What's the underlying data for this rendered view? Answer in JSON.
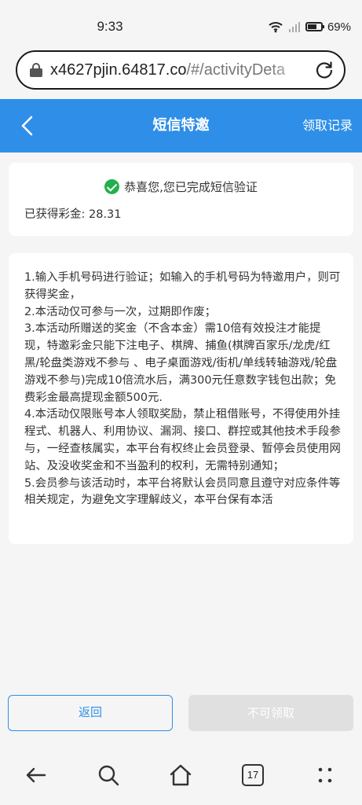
{
  "status_bar": {
    "time": "9:33",
    "battery_percent": "69%",
    "icons": [
      "wifi-icon",
      "signal-icon",
      "battery-icon"
    ]
  },
  "url_bar": {
    "host": "x4627pjin.64817.co",
    "path": "/#/activityDeta",
    "icons": [
      "lock-icon",
      "reload-icon"
    ]
  },
  "header": {
    "title": "短信特邀",
    "records_link": "领取记录",
    "background": "#2f8fe8"
  },
  "verification": {
    "message": "恭喜您,您已完成短信验证",
    "bonus_label": "已获得彩金: 28.31",
    "check_color": "#22b04a"
  },
  "rules": {
    "paragraphs": [
      "1.输入手机号码进行验证；如输入的手机号码为特邀用户，则可获得奖金，",
      "2.本活动仅可参与一次，过期即作废；",
      "3.本活动所赠送的奖金（不含本金）需10倍有效投注才能提现，特邀彩金只能下注电子、棋牌、捕鱼(棋牌百家乐/龙虎/红黑/轮盘类游戏不参与 、电子桌面游戏/街机/单线转轴游戏/轮盘游戏不参与)完成10倍流水后，满300元任意数字钱包出款；免费彩金最高提现金额500元.",
      "4.本活动仅限账号本人领取奖励，禁止租借账号，不得使用外挂程式、机器人、利用协议、漏洞、接口、群控或其他技术手段参与，一经查核属实，本平台有权终止会员登录、暂停会员使用网站、及没收奖金和不当盈利的权利，无需特别通知；",
      "5.会员参与该活动时，本平台将默认会员同意且遵守对应条件等相关规定，为避免文字理解歧义，本平台保有本活"
    ]
  },
  "buttons": {
    "back": "返回",
    "claim": "不可领取"
  },
  "nav_bar": {
    "tab_count": "17",
    "icons": [
      "back-arrow-icon",
      "search-icon",
      "home-icon",
      "tabs-icon",
      "more-icon"
    ]
  }
}
